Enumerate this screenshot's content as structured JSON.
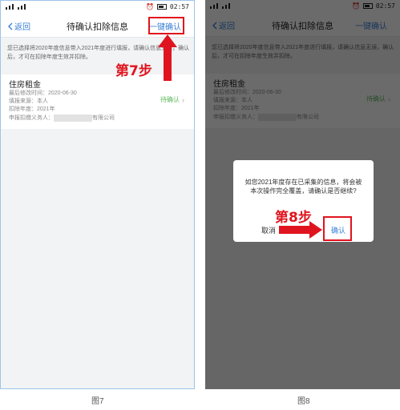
{
  "status_bar": {
    "network": "HD",
    "time": "02:57",
    "alarm_icon": "alarm-icon"
  },
  "nav": {
    "back_label": "返回",
    "title": "待确认扣除信息",
    "confirm_all_label": "一键确认"
  },
  "notice": "您已选择将2020年度信息带入2021年度进行填报，请确认信息无误，确认后，才可在扣除年度生效并扣除。",
  "card": {
    "title": "住房租金",
    "last_modified": "最后修改时间：2020-06-30",
    "source": "填报来源：本人",
    "deduction_year": "扣除年度：2021年",
    "withholding_agent_prefix": "申报扣缴义务人：",
    "withholding_agent_suffix": "有限公司",
    "status": "待确认"
  },
  "dialog": {
    "message": "如您2021年度存在已采集的信息，将会被本次操作完全覆盖，请确认是否继续?",
    "cancel_label": "取消",
    "ok_label": "确认"
  },
  "annotations": {
    "step7": "第7步",
    "step8": "第8步"
  },
  "captions": {
    "left": "图7",
    "right": "图8"
  },
  "colors": {
    "accent": "#3a7fd5",
    "highlight": "#e0141e",
    "status_green": "#5cb85c"
  }
}
